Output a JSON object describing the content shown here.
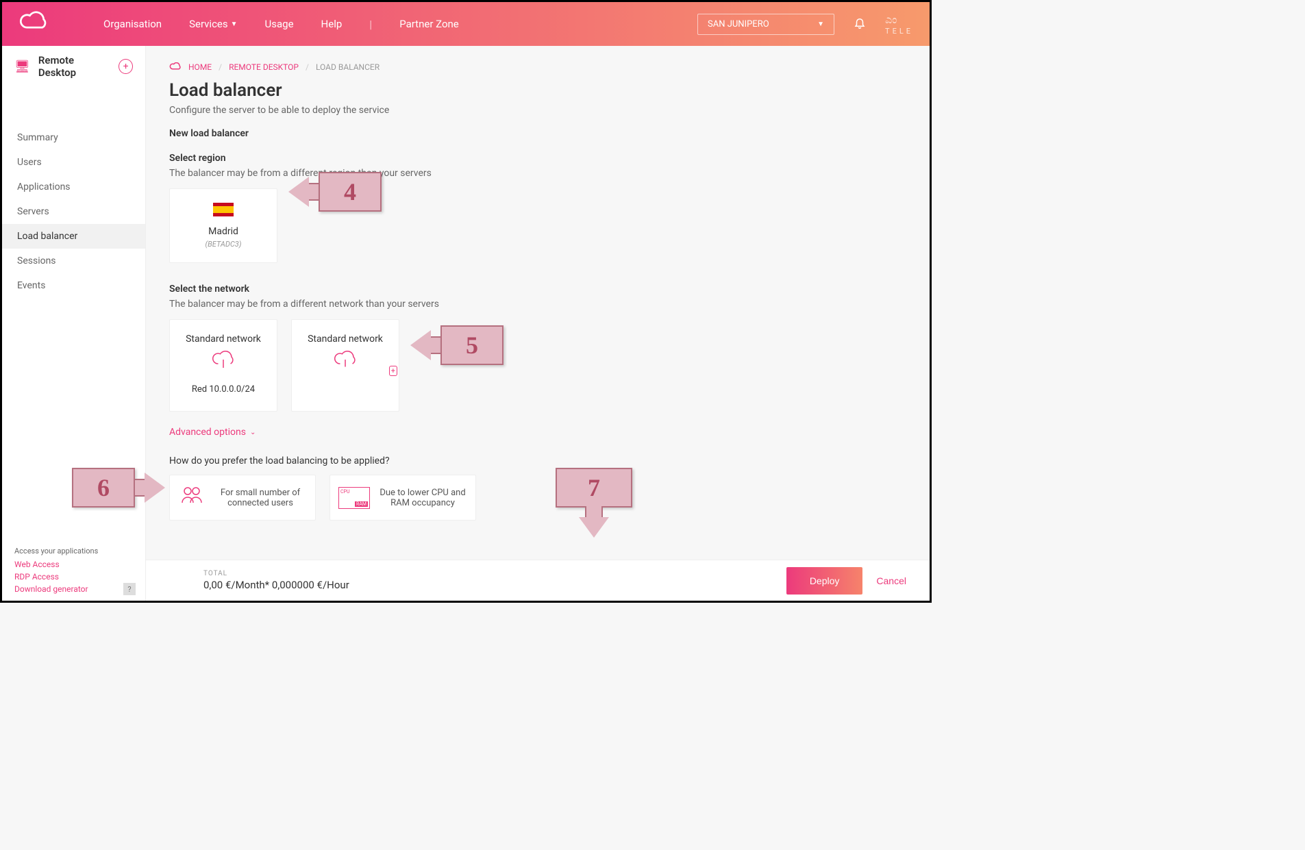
{
  "header": {
    "nav": {
      "organisation": "Organisation",
      "services": "Services",
      "usage": "Usage",
      "help": "Help",
      "partner": "Partner Zone"
    },
    "org_selected": "SAN JUNIPERO",
    "brand_right": "TELE"
  },
  "sidebar": {
    "title": "Remote Desktop",
    "items": [
      "Summary",
      "Users",
      "Applications",
      "Servers",
      "Load balancer",
      "Sessions",
      "Events"
    ],
    "active_index": 4,
    "footer_title": "Access your applications",
    "footer_links": [
      "Web Access",
      "RDP Access",
      "Download generator"
    ]
  },
  "breadcrumb": {
    "home": "HOME",
    "parent": "REMOTE DESKTOP",
    "current": "LOAD BALANCER"
  },
  "page": {
    "title": "Load balancer",
    "subtitle": "Configure the server to be able to deploy the service",
    "form_title": "New load balancer",
    "region": {
      "label": "Select region",
      "note": "The balancer may be from a different region than your servers",
      "card": {
        "city": "Madrid",
        "code": "(BETADC3)"
      }
    },
    "network": {
      "label": "Select the network",
      "note": "The balancer may be from a different network than your servers",
      "card1": {
        "title": "Standard network",
        "sub": "Red 10.0.0.0/24"
      },
      "card2": {
        "title": "Standard network"
      }
    },
    "advanced": "Advanced options",
    "pref": {
      "question": "How do you prefer the load balancing to be applied?",
      "opt1": "For small number of connected users",
      "opt2": "Due to lower CPU and RAM occupancy"
    }
  },
  "bottom": {
    "total_label": "TOTAL",
    "total_value": "0,00 €/Month* 0,000000 €/Hour",
    "deploy": "Deploy",
    "cancel": "Cancel"
  },
  "callouts": {
    "c4": "4",
    "c5": "5",
    "c6": "6",
    "c7": "7"
  }
}
